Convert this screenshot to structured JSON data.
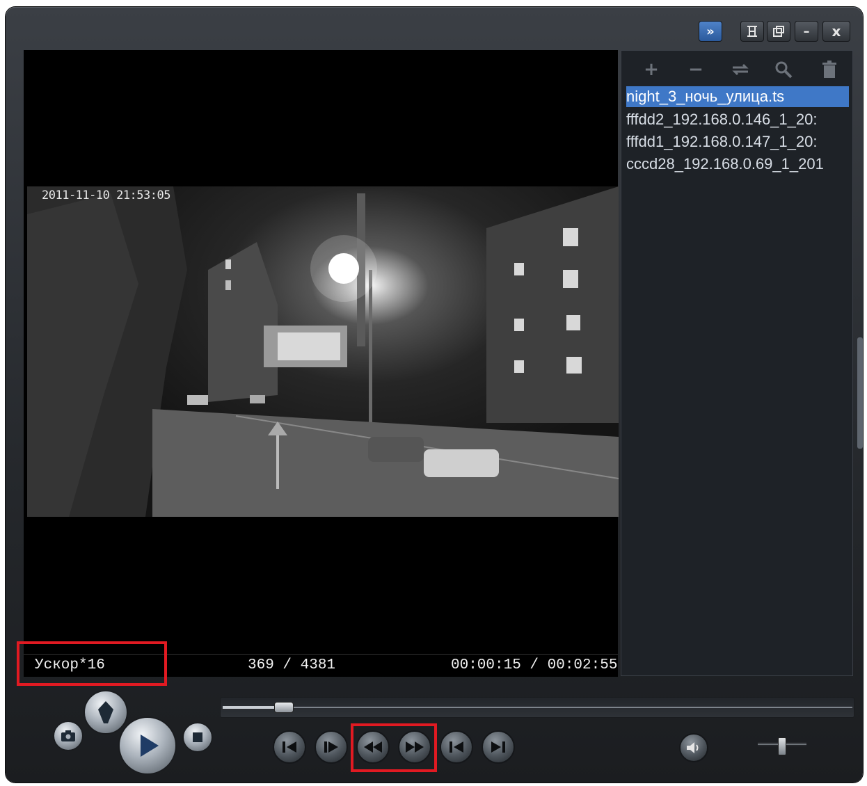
{
  "window": {
    "controls": {
      "playlist_toggle": "»",
      "minimize": "–",
      "close": "x"
    }
  },
  "video": {
    "osd_timestamp": "2011-11-10 21:53:05"
  },
  "status": {
    "speed": "Ускор*16",
    "frame_counter": "369 / 4381",
    "time": "00:00:15 / 00:02:55"
  },
  "playlist": {
    "toolbar": [
      "add-icon",
      "remove-icon",
      "repeat-icon",
      "search-icon",
      "trash-icon"
    ],
    "items": [
      {
        "label": "night_3_ночь_улица.ts",
        "selected": true
      },
      {
        "label": "fffdd2_192.168.0.146_1_20:",
        "selected": false
      },
      {
        "label": "fffdd1_192.168.0.147_1_20:",
        "selected": false
      },
      {
        "label": "cccd28_192.168.0.69_1_201",
        "selected": false
      }
    ]
  },
  "playback": {
    "seek_progress": 0.1,
    "volume_level": 0.5
  },
  "highlight_color": "#e11a22",
  "selection_color": "#3f78c7"
}
